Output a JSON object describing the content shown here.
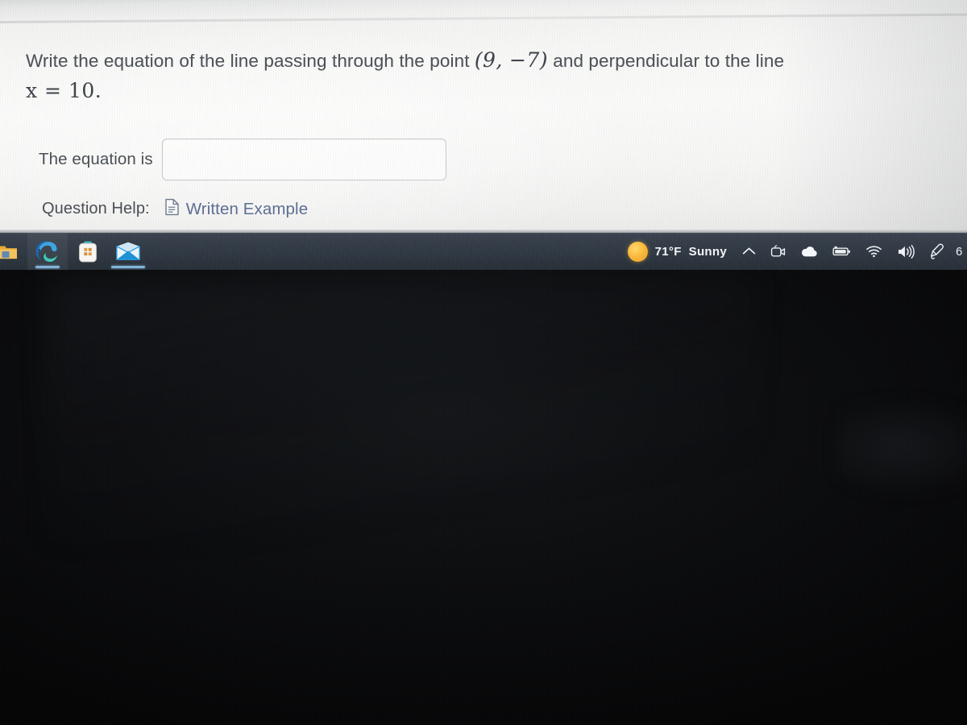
{
  "question": {
    "part1": "Write the equation of the line passing through the point ",
    "point": "(9, −7)",
    "part2": " and perpendicular to the line",
    "equation": "x = 10."
  },
  "answer": {
    "label": "The equation is",
    "value": "",
    "placeholder": ""
  },
  "help": {
    "label": "Question Help:",
    "link_text": "Written Example",
    "icon": "document-icon",
    "link_color": "#5d6f92"
  },
  "taskbar": {
    "apps": [
      {
        "name": "file-explorer",
        "label": "File Explorer",
        "running": false
      },
      {
        "name": "microsoft-edge",
        "label": "Microsoft Edge",
        "running": true
      },
      {
        "name": "microsoft-store",
        "label": "Microsoft Store",
        "running": false
      },
      {
        "name": "mail",
        "label": "Mail",
        "running": true
      }
    ],
    "weather": {
      "icon": "sun-icon",
      "temperature": "71°F",
      "condition": "Sunny",
      "sun_color": "#f9b93b"
    },
    "tray": [
      {
        "name": "show-hidden-icons",
        "icon": "chevron-up-icon"
      },
      {
        "name": "teams-meet",
        "icon": "video-camera-icon"
      },
      {
        "name": "onedrive",
        "icon": "cloud-icon"
      },
      {
        "name": "battery",
        "icon": "battery-charging-icon"
      },
      {
        "name": "network",
        "icon": "wifi-icon"
      },
      {
        "name": "volume",
        "icon": "speaker-icon"
      },
      {
        "name": "pen-menu",
        "icon": "pen-icon"
      }
    ],
    "clock": "6",
    "background_color": "#2d3640",
    "running_indicator_color": "#7fb3d9"
  },
  "colors": {
    "panel_background": "#fafaf9",
    "text": "#4e5358",
    "input_border": "#c8cacb"
  }
}
